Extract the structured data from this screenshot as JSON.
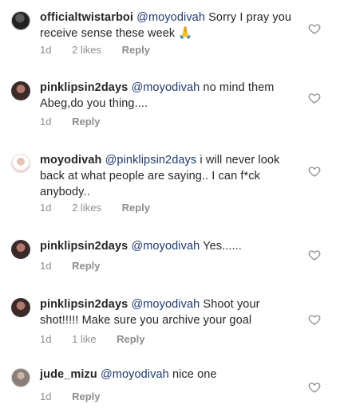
{
  "comments": [
    {
      "username": "officialtwistarboi",
      "mention": "@moyodivah",
      "text": "Sorry I pray you receive sense these week",
      "emoji": "🙏",
      "time": "1d",
      "likes": "2 likes",
      "reply": "Reply",
      "avatar": "avatar-dark"
    },
    {
      "username": "pinklipsin2days",
      "mention": "@moyodivah",
      "text": "no mind them Abeg,do you thing....",
      "time": "1d",
      "likes": "",
      "reply": "Reply",
      "avatar": "avatar-brown"
    },
    {
      "username": "moyodivah",
      "mention": "@pinklipsin2days",
      "text": "i will never look back at what people are saying.. I can f*ck anybody..",
      "time": "1d",
      "likes": "2 likes",
      "reply": "Reply",
      "avatar": "avatar-light"
    },
    {
      "username": "pinklipsin2days",
      "mention": "@moyodivah",
      "text": "Yes......",
      "time": "1d",
      "likes": "",
      "reply": "Reply",
      "avatar": "avatar-brown"
    },
    {
      "username": "pinklipsin2days",
      "mention": "@moyodivah",
      "text": "Shoot your shot!!!!! Make sure you archive your goal",
      "time": "1d",
      "likes": "1 like",
      "reply": "Reply",
      "avatar": "avatar-brown"
    },
    {
      "username": "jude_mizu",
      "mention": "@moyodivah",
      "text": "nice one",
      "time": "1d",
      "likes": "",
      "reply": "Reply",
      "avatar": "avatar-grey"
    }
  ],
  "icons": {
    "like": "heart-outline-icon"
  },
  "colors": {
    "text": "#262626",
    "mention": "#1e3a6e",
    "meta": "#8e8e8e"
  }
}
